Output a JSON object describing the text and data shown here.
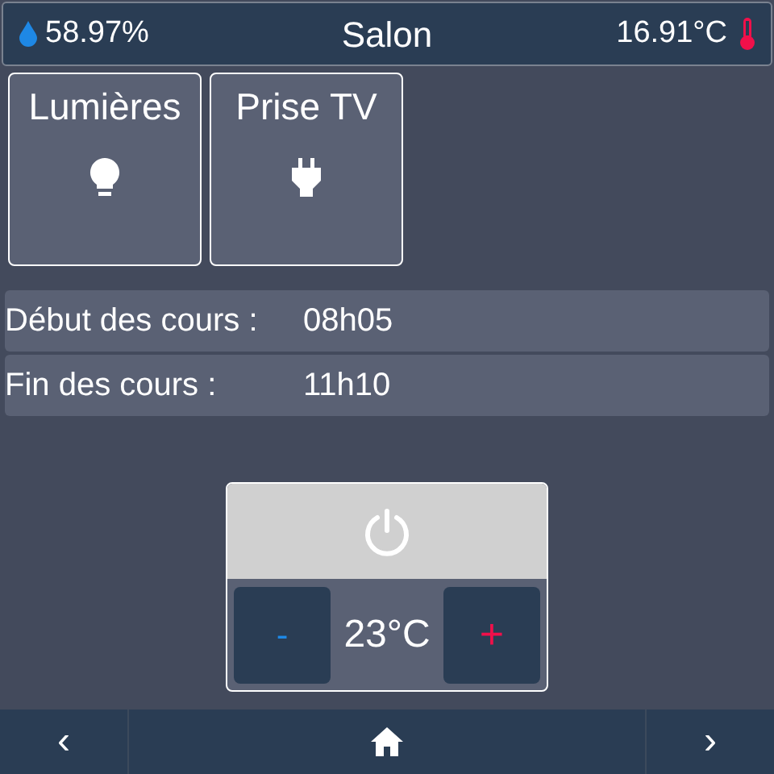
{
  "header": {
    "humidity": "58.97%",
    "title": "Salon",
    "temperature": "16.91°C"
  },
  "tiles": [
    {
      "label": "Lumières",
      "kind": "bulb"
    },
    {
      "label": "Prise TV",
      "kind": "plug"
    }
  ],
  "schedule": [
    {
      "label": "Début des cours :",
      "value": "08h05"
    },
    {
      "label": "Fin des cours :",
      "value": "11h10"
    }
  ],
  "thermostat": {
    "minus": "-",
    "setpoint": "23°C",
    "plus": "+"
  },
  "nav": {
    "previous": "‹",
    "next": "›"
  }
}
